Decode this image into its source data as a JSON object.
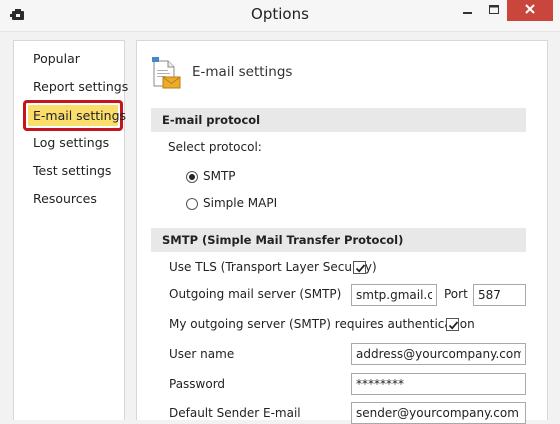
{
  "window": {
    "title": "Options",
    "icons": {
      "app": "app-logo-icon",
      "minimize": "minimize-icon",
      "maximize": "maximize-icon",
      "close": "close-icon"
    },
    "colors": {
      "close_bg": "#c9463d",
      "selected_bg": "#fbdd6b",
      "selected_border": "#c4141d",
      "section_bg": "#e8e8e8"
    }
  },
  "sidebar": {
    "items": [
      {
        "label": "Popular"
      },
      {
        "label": "Report settings"
      },
      {
        "label": "E-mail settings",
        "selected": true
      },
      {
        "label": "Log settings"
      },
      {
        "label": "Test settings"
      },
      {
        "label": "Resources"
      }
    ]
  },
  "main": {
    "header_title": "E-mail settings",
    "header_icon": "email-settings-icon",
    "protocol_section": {
      "title": "E-mail protocol",
      "select_label": "Select protocol:",
      "options": [
        {
          "label": "SMTP",
          "selected": true
        },
        {
          "label": "Simple MAPI",
          "selected": false
        }
      ]
    },
    "smtp_section": {
      "title": "SMTP (Simple Mail Transfer Protocol)",
      "use_tls": {
        "label": "Use TLS (Transport Layer Security)",
        "checked": true
      },
      "server": {
        "label": "Outgoing mail server (SMTP)",
        "value": "smtp.gmail.com"
      },
      "port": {
        "label": "Port",
        "value": "587"
      },
      "auth": {
        "label": "My outgoing server (SMTP) requires authentication",
        "checked": true
      },
      "username": {
        "label": "User name",
        "value": "address@yourcompany.com"
      },
      "password": {
        "label": "Password",
        "value": "********"
      },
      "sender": {
        "label": "Default Sender E-mail",
        "value": "sender@yourcompany.com"
      }
    }
  }
}
